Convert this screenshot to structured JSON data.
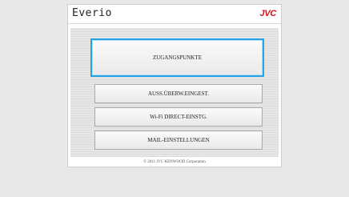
{
  "app": {
    "title": "Everio",
    "brand_logo": "JVC"
  },
  "menu": {
    "items": [
      {
        "label": "ZUGANGSPUNKTE",
        "selected": true
      },
      {
        "label": "AUSS.ÜBERW.EINGEST."
      },
      {
        "label": "Wi-Fi DIRECT-EINSTG."
      },
      {
        "label": "MAIL-EINSTELLUNGEN"
      }
    ]
  },
  "footer": {
    "copyright": "© 2011 JVC KENWOOD Corporation"
  },
  "colors": {
    "accent": "#23a3e6",
    "logo": "#d4151b",
    "background": "#e8e8e8"
  }
}
